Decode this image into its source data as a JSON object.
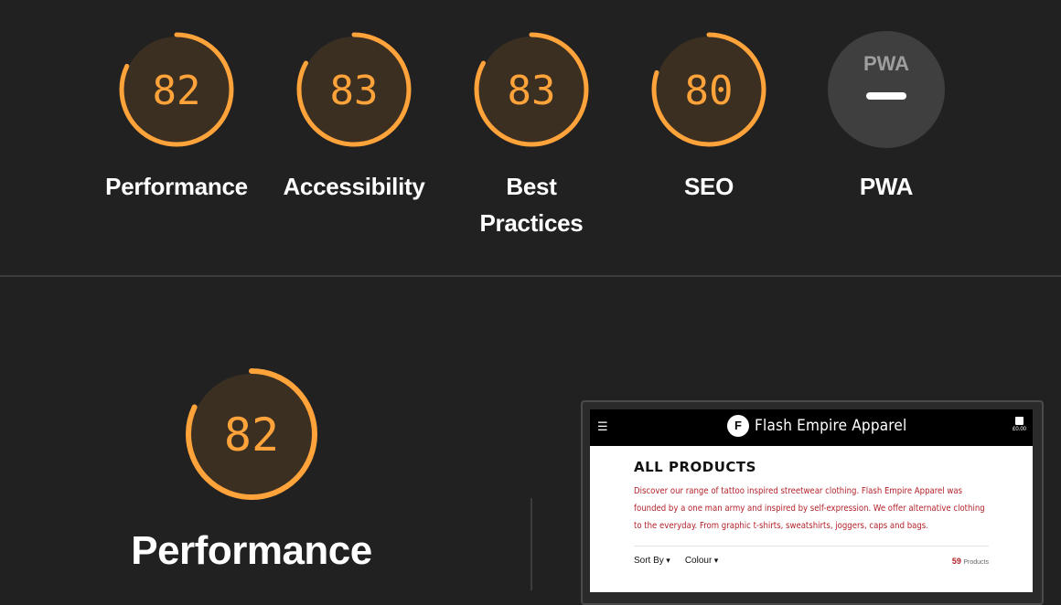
{
  "colors": {
    "accent": "#ffa33a",
    "ring_bg": "#3b2f22",
    "pwa_bg": "#3f3f3f"
  },
  "gauges": [
    {
      "score": "82",
      "value": 82,
      "label": "Performance"
    },
    {
      "score": "83",
      "value": 83,
      "label": "Accessibility"
    },
    {
      "score": "83",
      "value": 83,
      "label_line1": "Best",
      "label_line2": "Practices"
    },
    {
      "score": "80",
      "value": 80,
      "label": "SEO"
    },
    {
      "badge": "PWA",
      "label": "PWA"
    }
  ],
  "section": {
    "score": "82",
    "value": 82,
    "title": "Performance"
  },
  "preview": {
    "brand": "Flash Empire Apparel",
    "cart_price": "£0.00",
    "heading": "ALL PRODUCTS",
    "description": "Discover our range of tattoo inspired streetwear clothing. Flash Empire Apparel was founded by a one man army and inspired by self-expression. We offer alternative clothing to the everyday. From graphic t-shirts, sweatshirts, joggers, caps and bags.",
    "sort_label": "Sort By",
    "colour_label": "Colour",
    "count": "59",
    "count_suffix": "Products"
  }
}
